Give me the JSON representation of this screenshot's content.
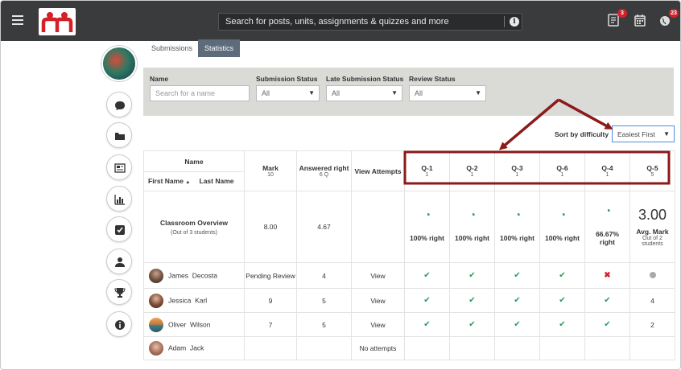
{
  "topbar": {
    "search_placeholder": "Search for posts, units, assignments & quizzes and more",
    "notifications": [
      {
        "icon": "assignment-icon",
        "count": "3"
      },
      {
        "icon": "calendar-icon",
        "count": ""
      },
      {
        "icon": "globe-icon",
        "count": "23"
      }
    ]
  },
  "tabs": [
    {
      "label": "Submissions",
      "active": false
    },
    {
      "label": "Statistics",
      "active": true
    }
  ],
  "filters": {
    "name": {
      "label": "Name",
      "placeholder": "Search for a name"
    },
    "submission_status": {
      "label": "Submission Status",
      "value": "All"
    },
    "late_submission_status": {
      "label": "Late Submission Status",
      "value": "All"
    },
    "review_status": {
      "label": "Review Status",
      "value": "All"
    }
  },
  "sort": {
    "label": "Sort by difficulty",
    "value": "Easiest First"
  },
  "table": {
    "name_header": "Name",
    "first_name_header": "First Name",
    "last_name_header": "Last Name",
    "mark_header": "Mark",
    "mark_sub": "10",
    "answered_header": "Answered right",
    "answered_sub": "6 Q",
    "view_header": "View Attempts",
    "questions": [
      {
        "label": "Q-1",
        "sub": "1"
      },
      {
        "label": "Q-2",
        "sub": "1"
      },
      {
        "label": "Q-3",
        "sub": "1"
      },
      {
        "label": "Q-6",
        "sub": "1"
      },
      {
        "label": "Q-4",
        "sub": "1"
      },
      {
        "label": "Q-5",
        "sub": "5"
      }
    ],
    "overview": {
      "title": "Classroom Overview",
      "sub": "(Out of 3 students)",
      "mark": "8.00",
      "answered": "4.67",
      "question_stats": [
        "100% right",
        "100% right",
        "100% right",
        "100% right",
        "66.67% right"
      ],
      "question_pcts": [
        100,
        100,
        100,
        100,
        66.67
      ],
      "avg_value": "3.00",
      "avg_label": "Avg. Mark",
      "avg_sub": "Out of 2 students"
    },
    "students": [
      {
        "first": "James",
        "last": "Decosta",
        "mark": "Pending Review",
        "answered": "4",
        "view": "View",
        "results": [
          "check",
          "check",
          "check",
          "check",
          "cross",
          "dot"
        ]
      },
      {
        "first": "Jessica",
        "last": "Karl",
        "mark": "9",
        "answered": "5",
        "view": "View",
        "results": [
          "check",
          "check",
          "check",
          "check",
          "check",
          "4"
        ]
      },
      {
        "first": "Oliver",
        "last": "Wilson",
        "mark": "7",
        "answered": "5",
        "view": "View",
        "results": [
          "check",
          "check",
          "check",
          "check",
          "check",
          "2"
        ]
      },
      {
        "first": "Adam",
        "last": "Jack",
        "mark": "",
        "answered": "",
        "view": "No attempts",
        "results": [
          "",
          "",
          "",
          "",
          "",
          ""
        ]
      }
    ]
  },
  "colors": {
    "topbar": "#3a3b3d",
    "active_tab": "#5d6b7a",
    "link": "#2e8b57",
    "pending": "#d0312d",
    "annotation": "#8b1a1a"
  }
}
